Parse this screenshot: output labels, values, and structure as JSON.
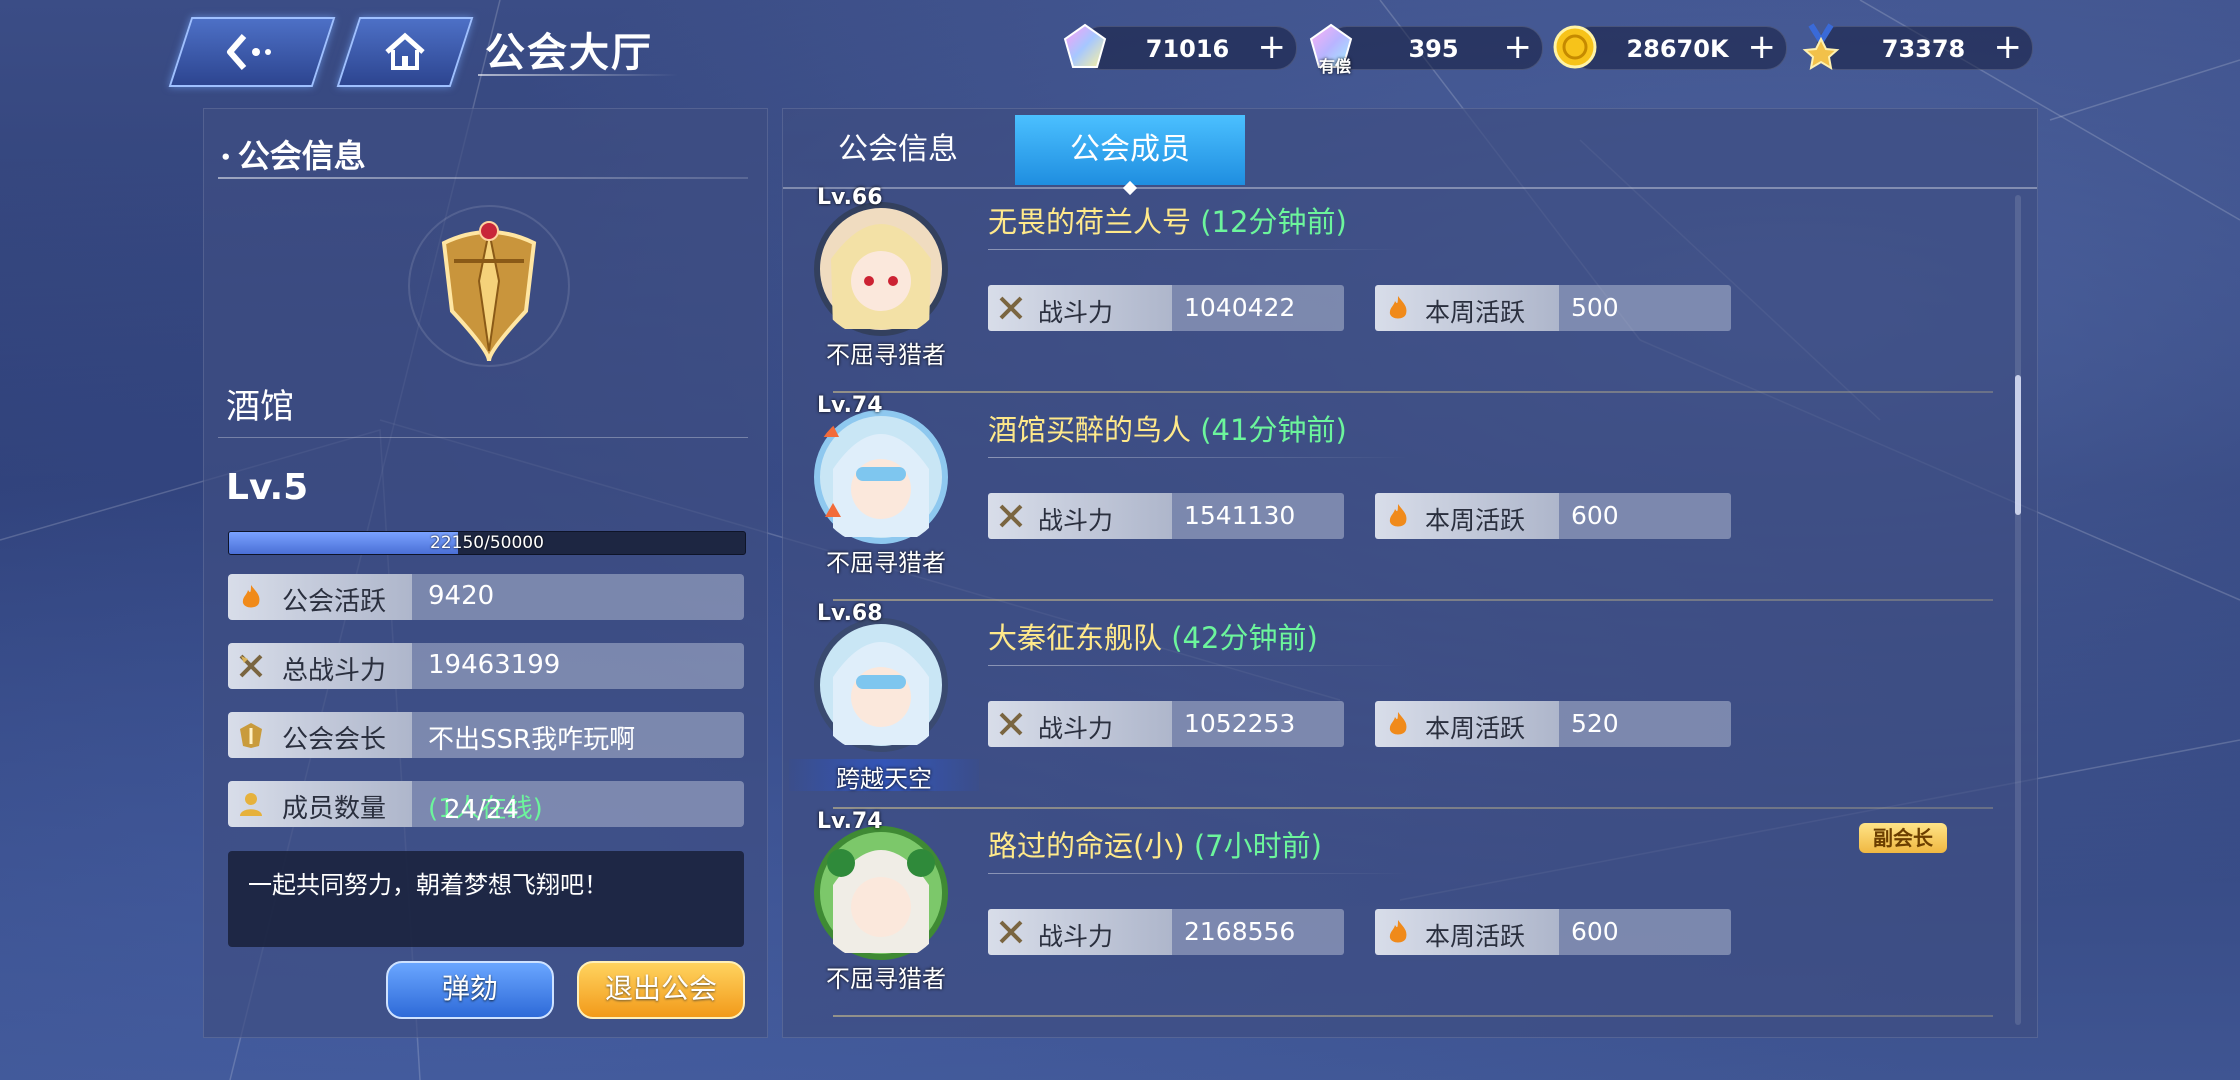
{
  "header": {
    "title": "公会大厅",
    "currencies": [
      {
        "name": "crystal-gem",
        "value": "71016"
      },
      {
        "name": "paid-gem",
        "value": "395",
        "tag": "有偿"
      },
      {
        "name": "gold-coin",
        "value": "28670K"
      },
      {
        "name": "medal",
        "value": "73378"
      }
    ],
    "plus_symbol": "+"
  },
  "guild_info": {
    "section_title": "公会信息",
    "name": "酒馆",
    "level": "Lv.5",
    "exp": {
      "current": 22150,
      "max": 50000,
      "text": "22150/50000"
    },
    "rows": [
      {
        "icon": "flame-icon",
        "label": "公会活跃",
        "value": "9420"
      },
      {
        "icon": "crossed-swords-icon",
        "label": "总战斗力",
        "value": "19463199"
      },
      {
        "icon": "leader-icon",
        "label": "公会会长",
        "value": "不出SSR我咋玩啊"
      },
      {
        "icon": "member-icon",
        "label": "成员数量",
        "value": "24/24",
        "extra": "(1人在线)"
      }
    ],
    "motto": "一起共同努力，朝着梦想飞翔吧！",
    "buttons": {
      "impeach": "弹劾",
      "quit": "退出公会"
    }
  },
  "tabs": [
    {
      "label": "公会信息",
      "active": false
    },
    {
      "label": "公会成员",
      "active": true
    }
  ],
  "stat_labels": {
    "power": "战斗力",
    "weekly": "本周活跃"
  },
  "members": [
    {
      "level": "Lv.66",
      "name": "无畏的荷兰人号",
      "ago": "(12分钟前)",
      "title_badge": "不屈寻猎者",
      "power": "1040422",
      "weekly": "500",
      "role": ""
    },
    {
      "level": "Lv.74",
      "name": "酒馆买醉的鸟人",
      "ago": "(41分钟前)",
      "title_badge": "不屈寻猎者",
      "power": "1541130",
      "weekly": "600",
      "role": ""
    },
    {
      "level": "Lv.68",
      "name": "大秦征东舰队",
      "ago": "(42分钟前)",
      "title_badge": "跨越天空",
      "power": "1052253",
      "weekly": "520",
      "role": ""
    },
    {
      "level": "Lv.74",
      "name": "路过的命运(小)",
      "ago": "(7小时前)",
      "title_badge": "不屈寻猎者",
      "power": "2168556",
      "weekly": "600",
      "role": "副会长"
    }
  ],
  "colors": {
    "accent": "#1f8ee0",
    "online": "#6cf59c",
    "name": "#ffe98a"
  }
}
